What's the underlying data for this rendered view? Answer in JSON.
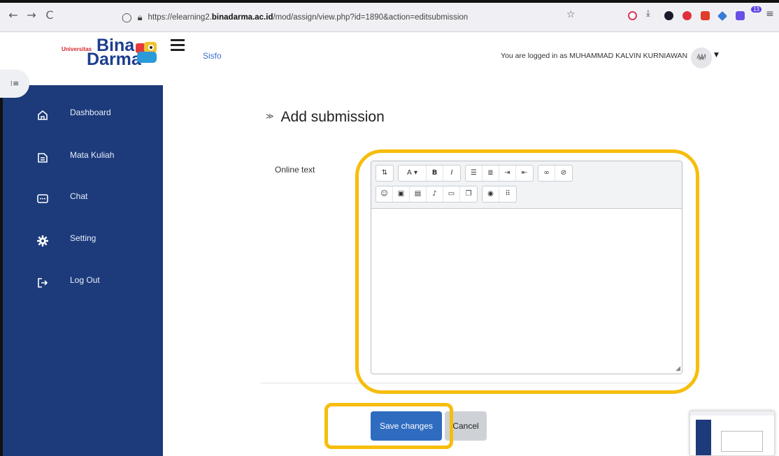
{
  "browser": {
    "back": "←",
    "forward": "→",
    "reload": "C",
    "url_prefix": "https://elearning2.",
    "url_domain": "binadarma.ac.id",
    "url_path": "/mod/assign/view.php?id=1890&action=editsubmission",
    "extension_badge": "13"
  },
  "header": {
    "logo_small": "Universitas",
    "logo_line1": "Bina",
    "logo_line2": "Darma",
    "nav_link": "Sisfo",
    "logged_in_text": "You are logged in as MUHAMMAD KALVIN KURNIAWAN",
    "avatar_initials": "AM",
    "avatar_sub": "MK"
  },
  "sidebar": {
    "items": [
      {
        "label": "Dashboard",
        "icon": "home-icon"
      },
      {
        "label": "Mata Kuliah",
        "icon": "document-icon"
      },
      {
        "label": "Chat",
        "icon": "chat-icon"
      },
      {
        "label": "Setting",
        "icon": "gear-icon"
      },
      {
        "label": "Log Out",
        "icon": "logout-icon"
      }
    ]
  },
  "main": {
    "title": "Add submission",
    "field_label": "Online text",
    "editor_value": "",
    "save_label": "Save changes",
    "cancel_label": "Cancel"
  },
  "colors": {
    "sidebar_bg": "#1d3b7a",
    "primary": "#2f6cc0",
    "highlight": "#f6bd0c"
  }
}
